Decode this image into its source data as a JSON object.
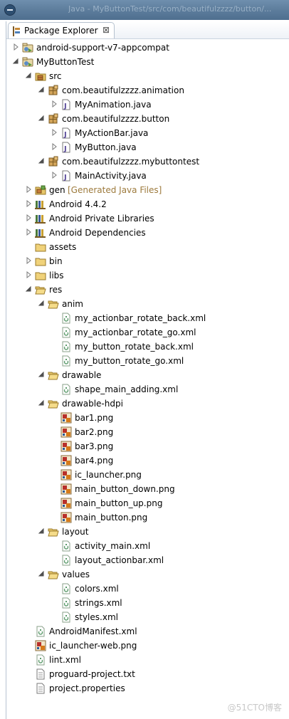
{
  "window": {
    "title": "Java - MyButtonTest/src/com/beautifulzzzz/button/..."
  },
  "tab": {
    "label": "Package Explorer",
    "close_glyph": "⊠"
  },
  "tree": [
    {
      "label": "android-support-v7-appcompat",
      "icon": "project-icon",
      "twisty": "collapsed"
    },
    {
      "label": "MyButtonTest",
      "icon": "project-icon",
      "twisty": "expanded"
    },
    {
      "label": "src",
      "icon": "source-folder-icon",
      "twisty": "expanded"
    },
    {
      "label": "com.beautifulzzzz.animation",
      "icon": "package-icon",
      "twisty": "expanded"
    },
    {
      "label": "MyAnimation.java",
      "icon": "java-file-icon",
      "twisty": "collapsed"
    },
    {
      "label": "com.beautifulzzzz.button",
      "icon": "package-icon",
      "twisty": "expanded"
    },
    {
      "label": "MyActionBar.java",
      "icon": "java-file-icon",
      "twisty": "collapsed"
    },
    {
      "label": "MyButton.java",
      "icon": "java-file-icon",
      "twisty": "collapsed"
    },
    {
      "label": "com.beautifulzzzz.mybuttontest",
      "icon": "package-icon",
      "twisty": "expanded"
    },
    {
      "label": "MainActivity.java",
      "icon": "java-file-icon",
      "twisty": "collapsed"
    },
    {
      "label": "gen",
      "decoration": "[Generated Java Files]",
      "icon": "gen-folder-icon",
      "twisty": "collapsed"
    },
    {
      "label": "Android 4.4.2",
      "icon": "library-icon",
      "twisty": "collapsed"
    },
    {
      "label": "Android Private Libraries",
      "icon": "library-icon",
      "twisty": "collapsed"
    },
    {
      "label": "Android Dependencies",
      "icon": "library-icon",
      "twisty": "collapsed"
    },
    {
      "label": "assets",
      "icon": "folder-icon",
      "twisty": "none"
    },
    {
      "label": "bin",
      "icon": "folder-icon",
      "twisty": "collapsed"
    },
    {
      "label": "libs",
      "icon": "folder-icon",
      "twisty": "collapsed"
    },
    {
      "label": "res",
      "icon": "open-folder-icon",
      "twisty": "expanded"
    },
    {
      "label": "anim",
      "icon": "open-folder-icon",
      "twisty": "expanded"
    },
    {
      "label": "my_actionbar_rotate_back.xml",
      "icon": "xml-file-icon",
      "twisty": "none"
    },
    {
      "label": "my_actionbar_rotate_go.xml",
      "icon": "xml-file-icon",
      "twisty": "none"
    },
    {
      "label": "my_button_rotate_back.xml",
      "icon": "xml-file-icon",
      "twisty": "none"
    },
    {
      "label": "my_button_rotate_go.xml",
      "icon": "xml-file-icon",
      "twisty": "none"
    },
    {
      "label": "drawable",
      "icon": "open-folder-icon",
      "twisty": "expanded"
    },
    {
      "label": "shape_main_adding.xml",
      "icon": "xml-file-icon",
      "twisty": "none"
    },
    {
      "label": "drawable-hdpi",
      "icon": "open-folder-icon",
      "twisty": "expanded"
    },
    {
      "label": "bar1.png",
      "icon": "image-file-icon",
      "twisty": "none"
    },
    {
      "label": "bar2.png",
      "icon": "image-file-icon",
      "twisty": "none"
    },
    {
      "label": "bar3.png",
      "icon": "image-file-icon",
      "twisty": "none"
    },
    {
      "label": "bar4.png",
      "icon": "image-file-icon",
      "twisty": "none"
    },
    {
      "label": "ic_launcher.png",
      "icon": "image-file-icon",
      "twisty": "none"
    },
    {
      "label": "main_button_down.png",
      "icon": "image-file-icon",
      "twisty": "none"
    },
    {
      "label": "main_button_up.png",
      "icon": "image-file-icon",
      "twisty": "none"
    },
    {
      "label": "main_button.png",
      "icon": "image-file-icon",
      "twisty": "none"
    },
    {
      "label": "layout",
      "icon": "open-folder-icon",
      "twisty": "expanded"
    },
    {
      "label": "activity_main.xml",
      "icon": "xml-file-icon",
      "twisty": "none"
    },
    {
      "label": "layout_actionbar.xml",
      "icon": "xml-file-icon",
      "twisty": "none"
    },
    {
      "label": "values",
      "icon": "open-folder-icon",
      "twisty": "expanded"
    },
    {
      "label": "colors.xml",
      "icon": "xml-file-icon",
      "twisty": "none"
    },
    {
      "label": "strings.xml",
      "icon": "xml-file-icon",
      "twisty": "none"
    },
    {
      "label": "styles.xml",
      "icon": "xml-file-icon",
      "twisty": "none"
    },
    {
      "label": "AndroidManifest.xml",
      "icon": "xml-file-icon",
      "twisty": "none"
    },
    {
      "label": "ic_launcher-web.png",
      "icon": "image-file-icon",
      "twisty": "none"
    },
    {
      "label": "lint.xml",
      "icon": "xml-file-icon",
      "twisty": "none"
    },
    {
      "label": "proguard-project.txt",
      "icon": "text-file-icon",
      "twisty": "none"
    },
    {
      "label": "project.properties",
      "icon": "text-file-icon",
      "twisty": "none"
    }
  ],
  "watermark": "@51CTO博客",
  "colors": {
    "decoration": "#9d7a3c",
    "titlebar": "#5d7d9c"
  }
}
